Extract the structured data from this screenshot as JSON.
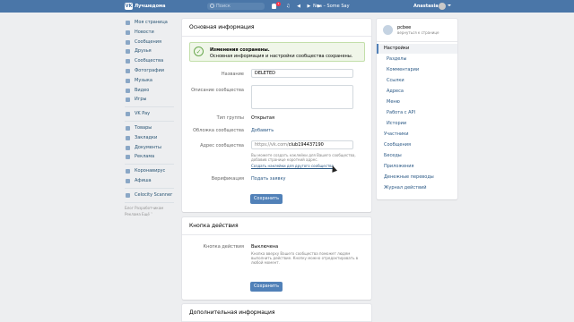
{
  "header": {
    "logo_letter": "VK",
    "logo_text": "Лучшедома",
    "search_placeholder": "Поиск",
    "notif_count": "1",
    "player_controls": "♫ ◀ ▶ ▶",
    "track": "Nea – Some Say",
    "user": "Anastasia"
  },
  "left_menu": {
    "items": [
      {
        "label": "Моя страница",
        "icon": "home-icon"
      },
      {
        "label": "Новости",
        "icon": "news-icon"
      },
      {
        "label": "Сообщения",
        "icon": "messages-icon"
      },
      {
        "label": "Друзья",
        "icon": "friends-icon"
      },
      {
        "label": "Сообщества",
        "icon": "communities-icon"
      },
      {
        "label": "Фотографии",
        "icon": "photos-icon"
      },
      {
        "label": "Музыка",
        "icon": "music-icon"
      },
      {
        "label": "Видео",
        "icon": "video-icon"
      },
      {
        "label": "Игры",
        "icon": "games-icon"
      }
    ],
    "items2": [
      {
        "label": "VK Pay",
        "icon": "vkpay-icon"
      }
    ],
    "items3": [
      {
        "label": "Товары",
        "icon": "goods-icon"
      },
      {
        "label": "Закладки",
        "icon": "bookmarks-icon"
      },
      {
        "label": "Документы",
        "icon": "documents-icon"
      },
      {
        "label": "Реклама",
        "icon": "ads-icon"
      }
    ],
    "items4": [
      {
        "label": "Коронавирус",
        "icon": "corona-icon"
      },
      {
        "label": "Афиша",
        "icon": "afisha-icon"
      }
    ],
    "items5": [
      {
        "label": "Celocity Scanner",
        "icon": "scanner-icon"
      }
    ],
    "footer_line1": "Блог  Разработчикам",
    "footer_line2": "Реклама  Ещё ˅"
  },
  "main": {
    "title": "Основная информация",
    "notice_title": "Изменения сохранены.",
    "notice_text": "Основная информация и настройки сообщества сохранены.",
    "name_label": "Название",
    "name_value": "DELETED",
    "desc_label": "Описание сообщества",
    "type_label": "Тип группы",
    "type_value": "Открытая",
    "cover_label": "Обложка сообщества",
    "cover_value": "Добавить",
    "address_label": "Адрес сообщества",
    "address_prefix": "https://vk.com/",
    "address_value": "club194437190",
    "address_hint1": "Вы можете создать наклейки для Вашего сообщества,",
    "address_hint2": "добавив странице короткий адрес.",
    "address_link": "Создать наклейки для другого сообщества",
    "verify_label": "Верификация",
    "verify_value": "Подать заявку",
    "save_label": "Сохранить"
  },
  "action": {
    "title": "Кнопка действия",
    "label": "Кнопка действия",
    "value": "Выключена",
    "hint1": "Кнопка вверху Вашего сообщества поможет людям",
    "hint2": "выполнить действие. Кнопку можно отредактировать в",
    "hint3": "любой момент.",
    "save_label": "Сохранить"
  },
  "extra": {
    "title": "Дополнительная информация"
  },
  "right_menu": {
    "name": "pcbee",
    "back": "вернуться к странице",
    "items": [
      "Настройки",
      "Разделы",
      "Комментарии",
      "Ссылки",
      "Адреса",
      "Меню",
      "Работа с API",
      "Истории",
      "Участники",
      "Сообщения",
      "Беседы",
      "Приложения",
      "Денежные переводы",
      "Журнал действий"
    ]
  }
}
